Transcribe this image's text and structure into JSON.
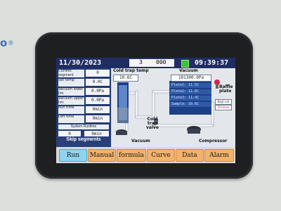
{
  "brand": {
    "text": "o",
    "reg": "®"
  },
  "header": {
    "date": "11/30/2023",
    "segment_number": "3",
    "counter": "000",
    "time": "09:39:37",
    "status_color": "#39c431"
  },
  "left_panel": {
    "rows": [
      {
        "label": "Current segment",
        "value": "0"
      },
      {
        "label": "Set temp",
        "value": "0.0C"
      },
      {
        "label": "Vacuum lower lim",
        "value": "0.0Pa"
      },
      {
        "label": "Vacuum upper lim",
        "value": "0.0Pa"
      },
      {
        "label": "Run time",
        "value": "0min"
      },
      {
        "label": "Left time",
        "value": "0min"
      }
    ],
    "system_runtime_label": "System Runtime",
    "system_runtime_hours": "0",
    "system_runtime_minutes": "0min",
    "skip_label": "Skip segments"
  },
  "diagram": {
    "cold_trap_temp_label": "Cold trap temp",
    "cold_trap_temp_value": "10.6C",
    "vacuum_label": "Vacuum",
    "vacuum_value": "101300.0Pa",
    "plates": [
      "Plate1: 11.5C",
      "Plate2: 11.6C",
      "Plate3: 11.4C",
      "Sample: 10.6C"
    ],
    "baffle_label": "Baffle plate",
    "english_label": "English",
    "chinese_label": "Chinese",
    "cold_trap_valve_label": "Cold trap valve",
    "vacuum_pump_label": "Vacuum",
    "compressor_label": "Compressor"
  },
  "bottom_bar": {
    "buttons": [
      "Run",
      "Manual",
      "formula",
      "Curve",
      "Data",
      "Alarm"
    ]
  }
}
